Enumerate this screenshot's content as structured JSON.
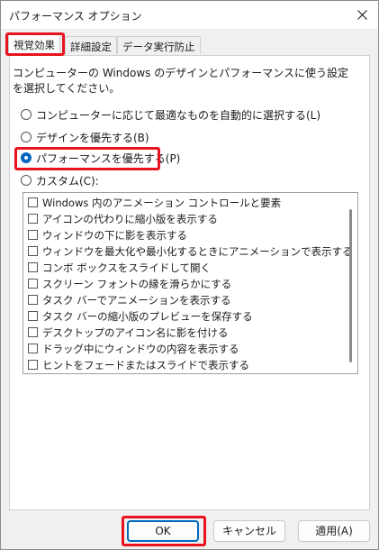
{
  "window": {
    "title": "パフォーマンス オプション"
  },
  "tabs": [
    {
      "label": "視覚効果"
    },
    {
      "label": "詳細設定"
    },
    {
      "label": "データ実行防止"
    }
  ],
  "visual_effects": {
    "description": "コンピューターの Windows のデザインとパフォーマンスに使う設定を選択してください。",
    "options": [
      {
        "label": "コンピューターに応じて最適なものを自動的に選択する(L)",
        "checked": false
      },
      {
        "label": "デザインを優先する(B)",
        "checked": false
      },
      {
        "label": "パフォーマンスを優先する(P)",
        "checked": true
      },
      {
        "label": "カスタム(C):",
        "checked": false
      }
    ],
    "effects": [
      {
        "label": "Windows 内のアニメーション コントロールと要素",
        "checked": false
      },
      {
        "label": "アイコンの代わりに縮小版を表示する",
        "checked": false
      },
      {
        "label": "ウィンドウの下に影を表示する",
        "checked": false
      },
      {
        "label": "ウィンドウを最大化や最小化するときにアニメーションで表示する",
        "checked": false
      },
      {
        "label": "コンボ ボックスをスライドして開く",
        "checked": false
      },
      {
        "label": "スクリーン フォントの縁を滑らかにする",
        "checked": false
      },
      {
        "label": "タスク バーでアニメーションを表示する",
        "checked": false
      },
      {
        "label": "タスク バーの縮小版のプレビューを保存する",
        "checked": false
      },
      {
        "label": "デスクトップのアイコン名に影を付ける",
        "checked": false
      },
      {
        "label": "ドラッグ中にウィンドウの内容を表示する",
        "checked": false
      },
      {
        "label": "ヒントをフェードまたはスライドで表示する",
        "checked": false
      }
    ]
  },
  "buttons": {
    "ok": "OK",
    "cancel": "キャンセル",
    "apply": "適用(A)"
  },
  "colors": {
    "highlight": "#e8131f",
    "accent": "#0067c0"
  }
}
